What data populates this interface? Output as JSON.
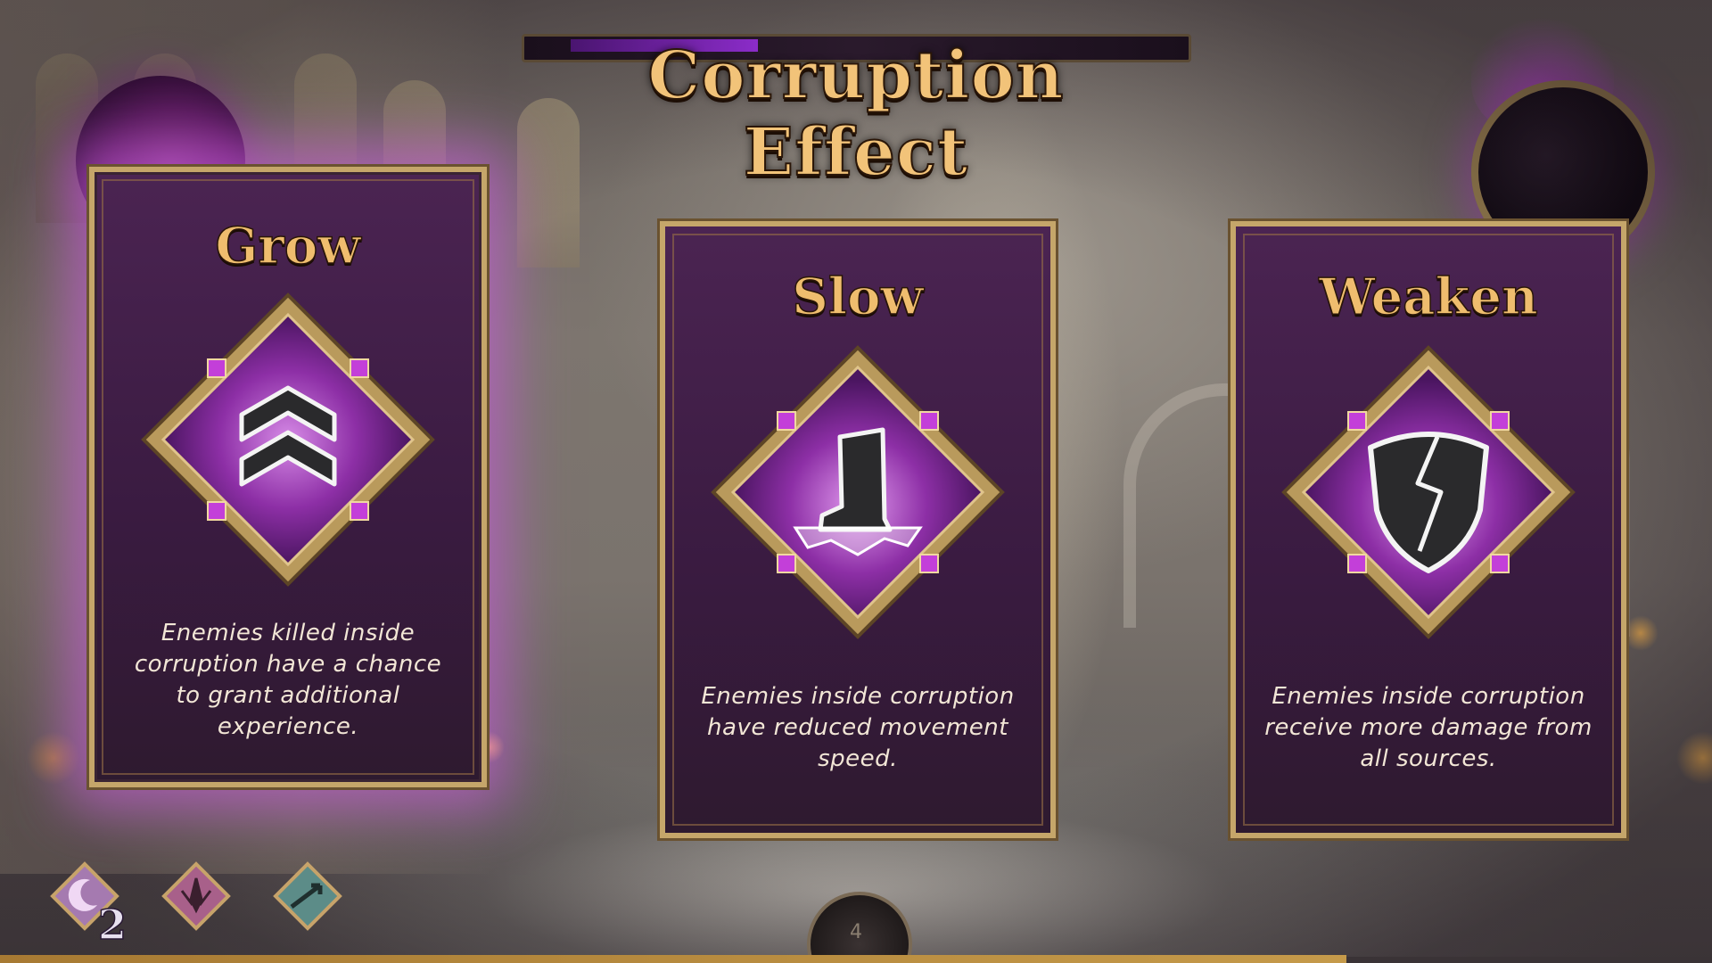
{
  "title": "Corruption Effect",
  "cards": [
    {
      "title": "Grow",
      "description": "Enemies killed inside corruption have a chance to grant additional experience.",
      "icon": "double-chevron-up-icon",
      "selected": true
    },
    {
      "title": "Slow",
      "description": "Enemies inside corruption have reduced movement speed.",
      "icon": "frozen-boot-icon",
      "selected": false
    },
    {
      "title": "Weaken",
      "description": "Enemies inside corruption receive more damage from all sources.",
      "icon": "broken-shield-icon",
      "selected": false
    }
  ],
  "hud": {
    "ability_count": "2",
    "wave_number": "4",
    "abilities": [
      "moon-ability-icon",
      "leaf-ability-icon",
      "arrow-ability-icon"
    ]
  },
  "colors": {
    "gold": "#c5a66a",
    "title_gold": "#f2c379",
    "card_purple": "#4b2452",
    "corruption_glow": "#c85ad8"
  }
}
